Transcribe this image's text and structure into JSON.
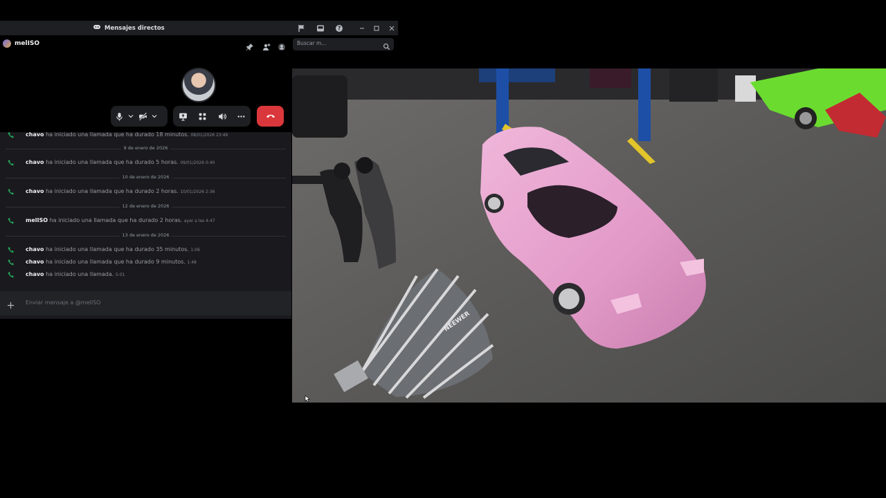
{
  "titlebar": {
    "title": "Mensajes directos",
    "icons": [
      "flag-icon",
      "inbox-icon",
      "help-icon",
      "minimize-icon",
      "maximize-icon",
      "close-icon"
    ]
  },
  "header": {
    "username": "melISO",
    "search_placeholder": "Buscar m...",
    "icons": [
      "pin-icon",
      "add-friends-icon",
      "profile-icon",
      "search-icon"
    ]
  },
  "call": {
    "controls": [
      "microphone-icon",
      "camera-off-icon",
      "screen-share-icon",
      "activities-icon",
      "soundboard-icon",
      "more-icon"
    ],
    "hangup": "hangup-icon"
  },
  "messages": [
    {
      "type": "call",
      "name": "chavo",
      "text": "ha iniciado una llamada que ha durado 18 minutos.",
      "time": "08/01/2026 23:49"
    },
    {
      "type": "divider",
      "label": "9 de enero de 2026"
    },
    {
      "type": "call",
      "name": "chavo",
      "text": "ha iniciado una llamada que ha durado 5 horas.",
      "time": "09/01/2026 0:40"
    },
    {
      "type": "divider",
      "label": "10 de enero de 2026"
    },
    {
      "type": "call",
      "name": "chavo",
      "text": "ha iniciado una llamada que ha durado 2 horas.",
      "time": "10/01/2026 2:36"
    },
    {
      "type": "divider",
      "label": "12 de enero de 2026"
    },
    {
      "type": "call",
      "name": "melISO",
      "text": "ha iniciado una llamada que ha durado 2 horas.",
      "time": "ayer a las 4:47"
    },
    {
      "type": "divider",
      "label": "13 de enero de 2026"
    },
    {
      "type": "call",
      "name": "chavo",
      "text": "ha iniciado una llamada que ha durado 35 minutos.",
      "time": "1:06"
    },
    {
      "type": "call",
      "name": "chavo",
      "text": "ha iniciado una llamada que ha durado 9 minutos.",
      "time": "1:48"
    },
    {
      "type": "call",
      "name": "chavo",
      "text": "ha iniciado una llamada.",
      "time": "5:01"
    }
  ],
  "composer": {
    "placeholder": "Enviar mensaje a @melISO"
  },
  "video": {
    "softbox_brand": "NEEWER"
  },
  "colors": {
    "accent_green": "#23a55a",
    "hangup_red": "#da373c",
    "car_pink": "#e7a6cf"
  }
}
